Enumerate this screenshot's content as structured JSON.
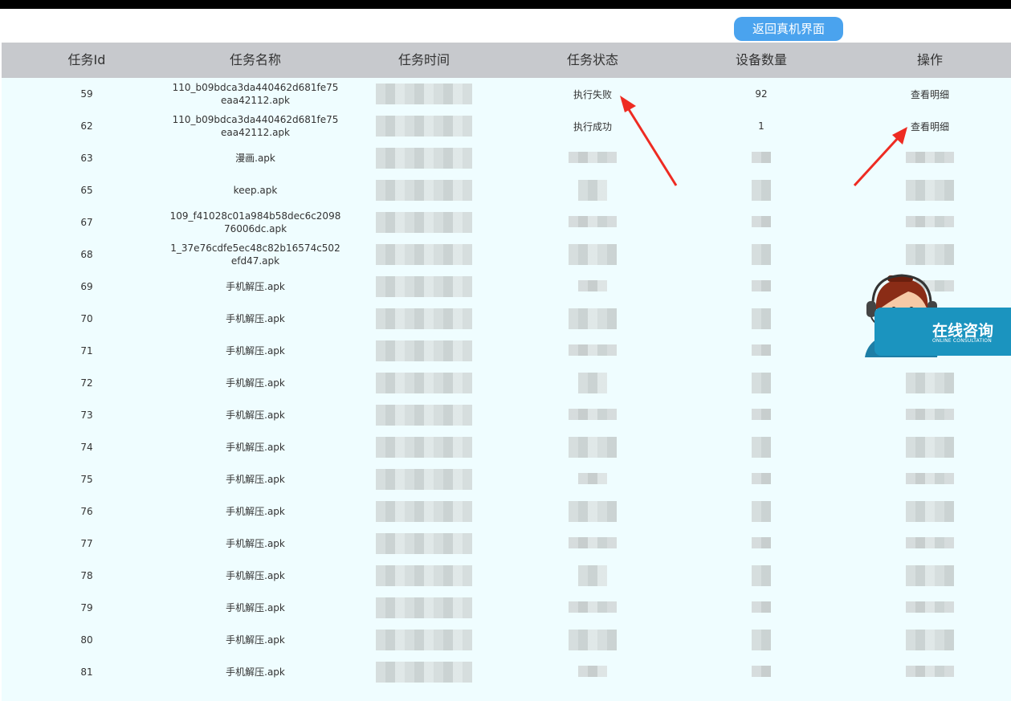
{
  "back_button_label": "返回真机界面",
  "table": {
    "headers": [
      "任务Id",
      "任务名称",
      "任务时间",
      "任务状态",
      "设备数量",
      "操作"
    ],
    "rows": [
      {
        "id": "59",
        "name": "110_b09bdca3da440462d681fe75eaa42112.apk",
        "status": "执行失败",
        "devices": "92",
        "action": "查看明细"
      },
      {
        "id": "62",
        "name": "110_b09bdca3da440462d681fe75eaa42112.apk",
        "status": "执行成功",
        "devices": "1",
        "action": "查看明细"
      },
      {
        "id": "63",
        "name": "漫画.apk"
      },
      {
        "id": "65",
        "name": "keep.apk"
      },
      {
        "id": "67",
        "name": "109_f41028c01a984b58dec6c209876006dc.apk"
      },
      {
        "id": "68",
        "name": "1_37e76cdfe5ec48c82b16574c502efd47.apk"
      },
      {
        "id": "69",
        "name": "手机解压.apk"
      },
      {
        "id": "70",
        "name": "手机解压.apk"
      },
      {
        "id": "71",
        "name": "手机解压.apk"
      },
      {
        "id": "72",
        "name": "手机解压.apk"
      },
      {
        "id": "73",
        "name": "手机解压.apk"
      },
      {
        "id": "74",
        "name": "手机解压.apk"
      },
      {
        "id": "75",
        "name": "手机解压.apk"
      },
      {
        "id": "76",
        "name": "手机解压.apk"
      },
      {
        "id": "77",
        "name": "手机解压.apk"
      },
      {
        "id": "78",
        "name": "手机解压.apk"
      },
      {
        "id": "79",
        "name": "手机解压.apk"
      },
      {
        "id": "80",
        "name": "手机解压.apk"
      },
      {
        "id": "81",
        "name": "手机解压.apk"
      }
    ]
  },
  "chat_widget": {
    "title": "在线咨询",
    "subtitle": "ONLINE CONSULTATION"
  },
  "colors": {
    "header_bg": "#c7c9cd",
    "table_bg": "#effdff",
    "button_bg": "#4aa3ee",
    "annotation_arrow": "#ee2b22",
    "widget_bg": "#1b94bf"
  }
}
